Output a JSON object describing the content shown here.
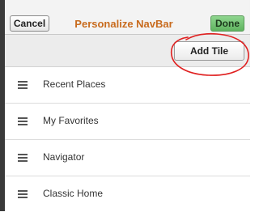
{
  "header": {
    "cancel_label": "Cancel",
    "title": "Personalize NavBar",
    "done_label": "Done"
  },
  "toolbar": {
    "add_tile_label": "Add Tile"
  },
  "nav_items": [
    {
      "label": "Recent Places",
      "icon": "drag-handle-icon"
    },
    {
      "label": "My Favorites",
      "icon": "drag-handle-icon"
    },
    {
      "label": "Navigator",
      "icon": "drag-handle-icon"
    },
    {
      "label": "Classic Home",
      "icon": "drag-handle-icon"
    }
  ],
  "colors": {
    "title": "#c86b1e",
    "done_button": "#6cbf6c",
    "annotation_circle": "#e02020"
  }
}
